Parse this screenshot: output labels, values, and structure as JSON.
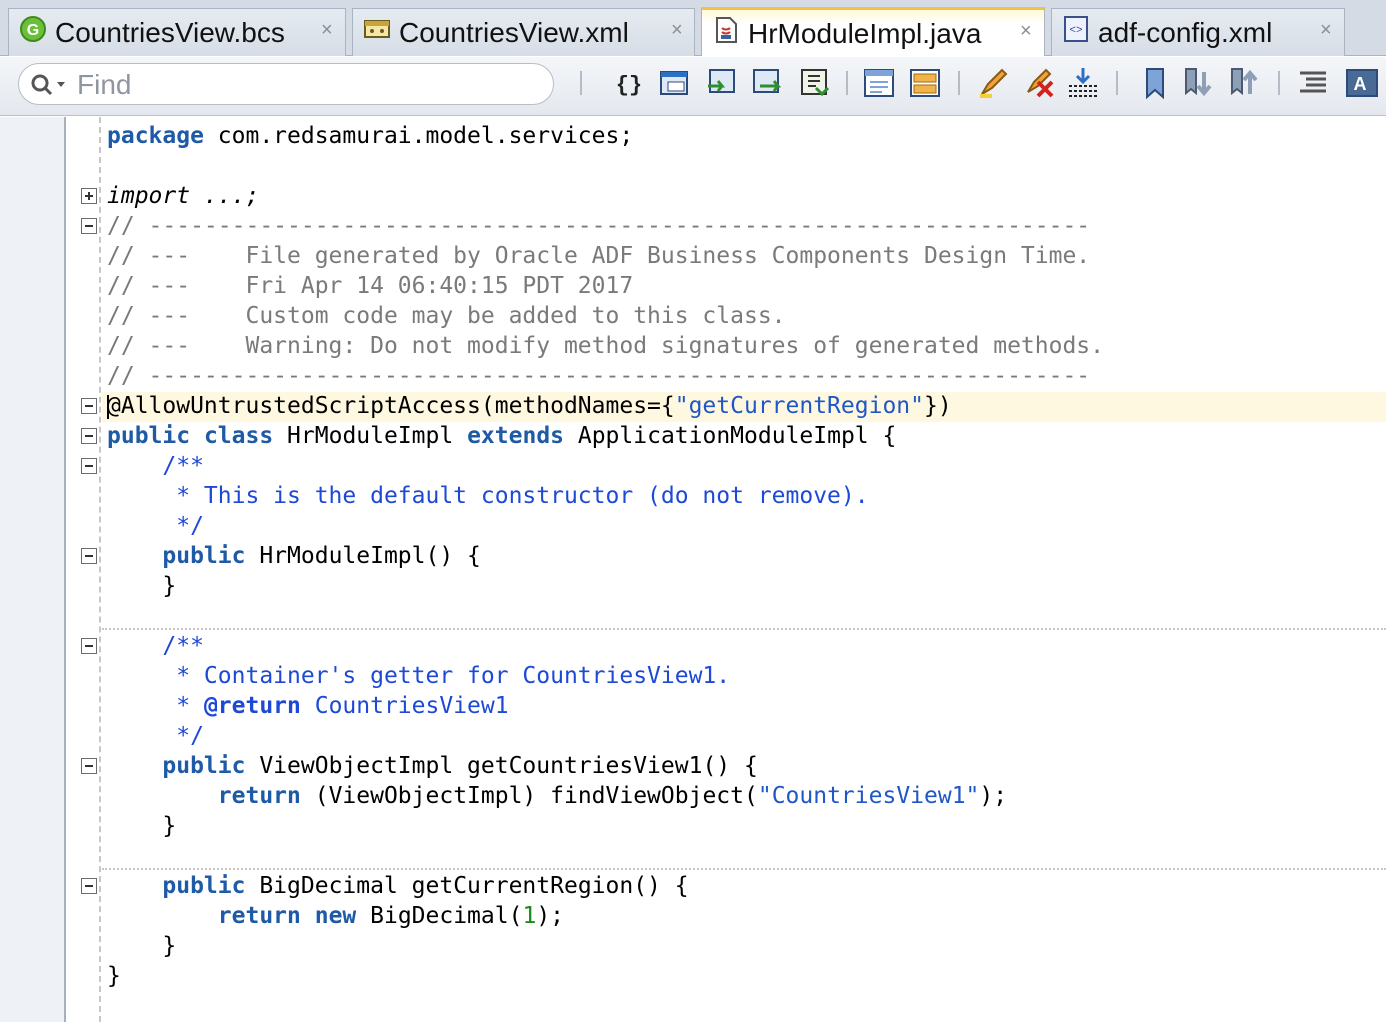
{
  "tabs": [
    {
      "label": "CountriesView.bcs",
      "icon": "green-circle-g-icon"
    },
    {
      "label": "CountriesView.xml",
      "icon": "view-object-icon"
    },
    {
      "label": "HrModuleImpl.java",
      "icon": "java-file-icon",
      "active": true
    },
    {
      "label": "adf-config.xml",
      "icon": "xml-file-icon"
    }
  ],
  "tab_close_symbol": "×",
  "toolbar": {
    "search_placeholder": "Find",
    "buttons": [
      "braces-icon",
      "source-frame-icon",
      "navigate-back-icon",
      "navigate-forward-icon",
      "navigate-down-icon",
      "window-frame-icon",
      "split-frame-icon",
      "highlight-icon",
      "clear-highlight-icon",
      "import-icon",
      "bookmark-icon",
      "next-bookmark-icon",
      "prev-bookmark-icon",
      "indent-icon",
      "format-icon"
    ]
  },
  "code": {
    "package_kw": "package",
    "package_name": " com.redsamurai.model.services;",
    "import_line": "import ...;",
    "comment_rule": "// --------------------------------------------------------------------",
    "comment_1": "// ---    File generated by Oracle ADF Business Components Design Time.",
    "comment_2": "// ---    Fri Apr 14 06:40:15 PDT 2017",
    "comment_3": "// ---    Custom code may be added to this class.",
    "comment_4": "// ---    Warning: Do not modify method signatures of generated methods.",
    "annotation_prefix": "@AllowUntrustedScriptAccess(methodNames={",
    "annotation_string": "\"getCurrentRegion\"",
    "annotation_suffix": "})",
    "class_public": "public",
    "class_kw": "class",
    "class_name": " HrModuleImpl ",
    "extends_kw": "extends",
    "class_parent": " ApplicationModuleImpl {",
    "doc1_open": "    /**",
    "doc1_body": "     * This is the default constructor (do not remove).",
    "doc1_close": "     */",
    "ctor_indent": "    ",
    "ctor_public": "public",
    "ctor_sig": " HrModuleImpl() {",
    "close_brace_4": "    }",
    "doc2_open": "    /**",
    "doc2_body": "     * Container's getter for CountriesView1.",
    "doc2_star": "     * ",
    "doc2_tag": "@return",
    "doc2_tag_text": " CountriesView1",
    "doc2_close": "     */",
    "getter_indent": "    ",
    "getter_public": "public",
    "getter_sig": " ViewObjectImpl getCountriesView1() {",
    "getter_ret_indent": "        ",
    "getter_return": "return",
    "getter_ret_body": " (ViewObjectImpl) findViewObject(",
    "getter_ret_string": "\"CountriesView1\"",
    "getter_ret_end": ");",
    "close_brace_4b": "    }",
    "region_indent": "    ",
    "region_public": "public",
    "region_sig": " BigDecimal getCurrentRegion() {",
    "region_ret_indent": "        ",
    "region_return": "return",
    "region_new": "new",
    "region_ret_body": " BigDecimal(",
    "region_num": "1",
    "region_ret_end": ");",
    "close_brace_4c": "    }",
    "close_brace_0": "}"
  },
  "colors": {
    "keyword": "#1e5aa5",
    "comment": "#7a7a7a",
    "javadoc": "#1d49d6",
    "string": "#1f57c8",
    "number": "#1a8b1a",
    "current_line": "#fff8e0",
    "active_tab_accent": "#f1c24a"
  }
}
